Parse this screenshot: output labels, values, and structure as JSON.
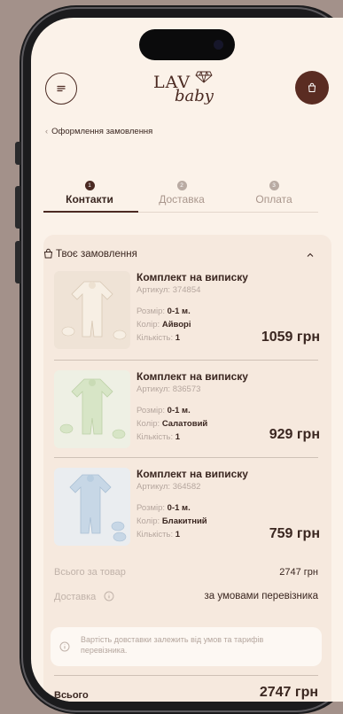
{
  "header": {
    "logo_main": "LAV",
    "logo_sub": "baby"
  },
  "breadcrumb": {
    "back_label": "Оформлення замовлення"
  },
  "steps": [
    {
      "num": "1",
      "label": "Контакти",
      "active": true
    },
    {
      "num": "2",
      "label": "Доставка",
      "active": false
    },
    {
      "num": "3",
      "label": "Оплата",
      "active": false
    }
  ],
  "order": {
    "title": "Твоє замовлення",
    "items": [
      {
        "name": "Комплект на виписку",
        "article_label": "Артикул:",
        "article": "374854",
        "size_label": "Розмір:",
        "size": "0-1 м.",
        "color_label": "Колір:",
        "color": "Айворі",
        "qty_label": "Кількість:",
        "qty": "1",
        "price": "1059 грн",
        "swatch": "#efe3d6"
      },
      {
        "name": "Комплект на виписку",
        "article_label": "Артикул:",
        "article": "836573",
        "size_label": "Розмір:",
        "size": "0-1 м.",
        "color_label": "Колір:",
        "color": "Салатовий",
        "qty_label": "Кількість:",
        "qty": "1",
        "price": "929 грн",
        "swatch": "#dde8cf"
      },
      {
        "name": "Комплект на виписку",
        "article_label": "Артикул:",
        "article": "364582",
        "size_label": "Розмір:",
        "size": "0-1 м.",
        "color_label": "Колір:",
        "color": "Блакитний",
        "qty_label": "Кількість:",
        "qty": "1",
        "price": "759 грн",
        "swatch": "#d6e2ec"
      }
    ],
    "subtotal_label": "Всього за товар",
    "subtotal_value": "2747 грн",
    "delivery_label": "Доставка",
    "delivery_value": "за умовами перевізника",
    "delivery_note": "Вартість довставки залежить від умов та тарифів перевізника.",
    "total_label": "Всього",
    "total_value": "2747 грн"
  },
  "colors": {
    "accent": "#4b2a22",
    "background": "#fbf2e9",
    "card": "#f6e9de"
  }
}
